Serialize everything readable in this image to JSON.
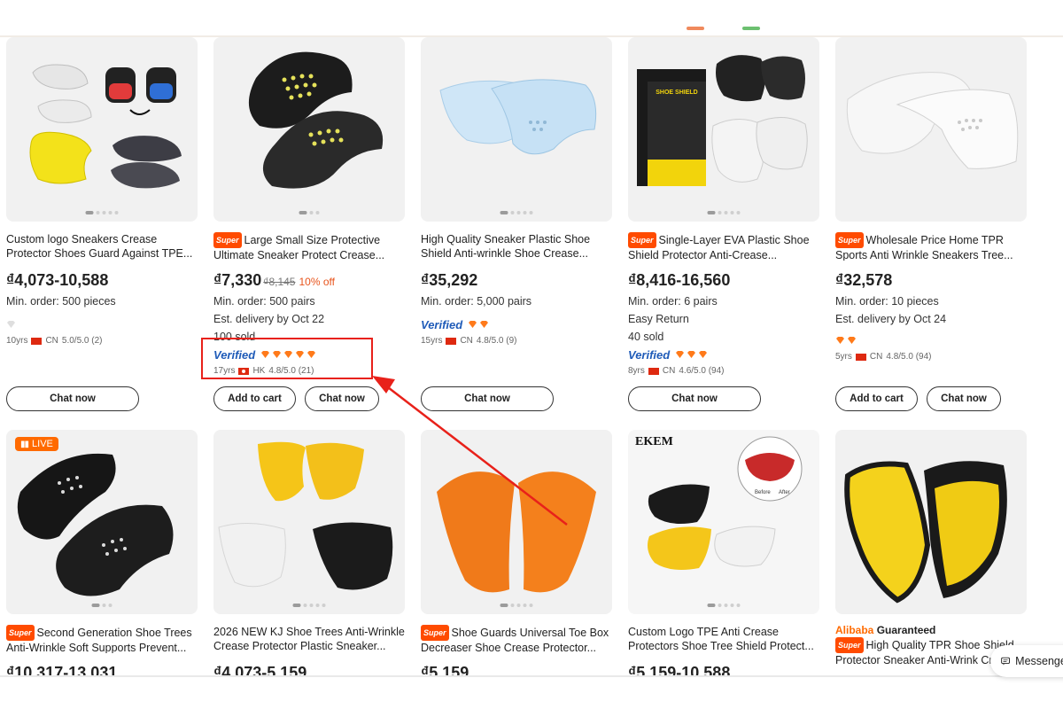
{
  "colors": {
    "accent": "#ff6a00",
    "price_off": "#e8541c",
    "verified": "#1f5bb8",
    "highlight": "#e8211a"
  },
  "row1": [
    {
      "title_line1": "Custom logo Sneakers Crease",
      "title_line2": "Protector Shoes Guard Against TPE...",
      "price": "₫4,073-10,588",
      "moq": "Min. order: 500 pieces",
      "supplier_years": "10yrs",
      "supplier_country": "CN",
      "supplier_rating": "5.0/5.0 (2)",
      "chat_label": "Chat now"
    },
    {
      "super": "Super",
      "title_line1": "Large Small Size Protective",
      "title_line2": "Ultimate Sneaker Protect Crease...",
      "price": "₫7,330",
      "price_old": "₫8,145",
      "price_off": "10% off",
      "moq": "Min. order: 500 pairs",
      "delivery": "Est. delivery by Oct 22",
      "sold": "100 sold",
      "verified": "Verified",
      "supplier_years": "17yrs",
      "supplier_country": "HK",
      "supplier_rating": "4.8/5.0 (21)",
      "cart_label": "Add to cart",
      "chat_label": "Chat now"
    },
    {
      "title_line1": "High Quality Sneaker Plastic Shoe",
      "title_line2": "Shield Anti-wrinkle Shoe Crease...",
      "price": "₫35,292",
      "moq": "Min. order: 5,000 pairs",
      "verified": "Verified",
      "supplier_years": "15yrs",
      "supplier_country": "CN",
      "supplier_rating": "4.8/5.0 (9)",
      "chat_label": "Chat now"
    },
    {
      "super": "Super",
      "title_line1": "Single-Layer EVA Plastic Shoe",
      "title_line2": "Shield Protector Anti-Crease...",
      "price": "₫8,416-16,560",
      "moq": "Min. order: 6 pairs",
      "easy_return": "Easy Return",
      "sold": "40 sold",
      "verified": "Verified",
      "supplier_years": "8yrs",
      "supplier_country": "CN",
      "supplier_rating": "4.6/5.0 (94)",
      "chat_label": "Chat now",
      "box_label": "SHOE SHIELD"
    },
    {
      "super": "Super",
      "title_line1": "Wholesale Price Home TPR",
      "title_line2": "Sports Anti Wrinkle Sneakers Tree...",
      "price": "₫32,578",
      "moq": "Min. order: 10 pieces",
      "delivery": "Est. delivery by Oct 24",
      "supplier_years": "5yrs",
      "supplier_country": "CN",
      "supplier_rating": "4.8/5.0 (94)",
      "cart_label": "Add to cart",
      "chat_label": "Chat now"
    }
  ],
  "row2": [
    {
      "live": "LIVE",
      "super": "Super",
      "title_line1": "Second Generation Shoe Trees",
      "title_line2": "Anti-Wrinkle Soft Supports Prevent...",
      "price": "₫10,317-13,031"
    },
    {
      "title_line1": "2026 NEW KJ Shoe Trees Anti-Wrinkle",
      "title_line2": "Crease Protector Plastic Sneaker...",
      "price": "₫4,073-5,159"
    },
    {
      "super": "Super",
      "title_line1": "Shoe Guards Universal Toe Box",
      "title_line2": "Decreaser Shoe Crease Protector...",
      "price": "₫5,159"
    },
    {
      "brand": "EKEM",
      "before": "Before",
      "after": "After",
      "title_line1": "Custom Logo TPE Anti Crease",
      "title_line2": "Protectors Shoe Tree Shield Protect...",
      "price": "₫5,159-10,588"
    },
    {
      "guaranteed_brand": "Alibaba",
      "guaranteed_text": "Guaranteed",
      "super": "Super",
      "title_line1": "High Quality TPR Shoe Shield",
      "title_line2": "Protector Sneaker Anti-Wrink Cr..."
    }
  ],
  "messenger": {
    "label": "Messenger",
    "icon": "message-icon"
  }
}
